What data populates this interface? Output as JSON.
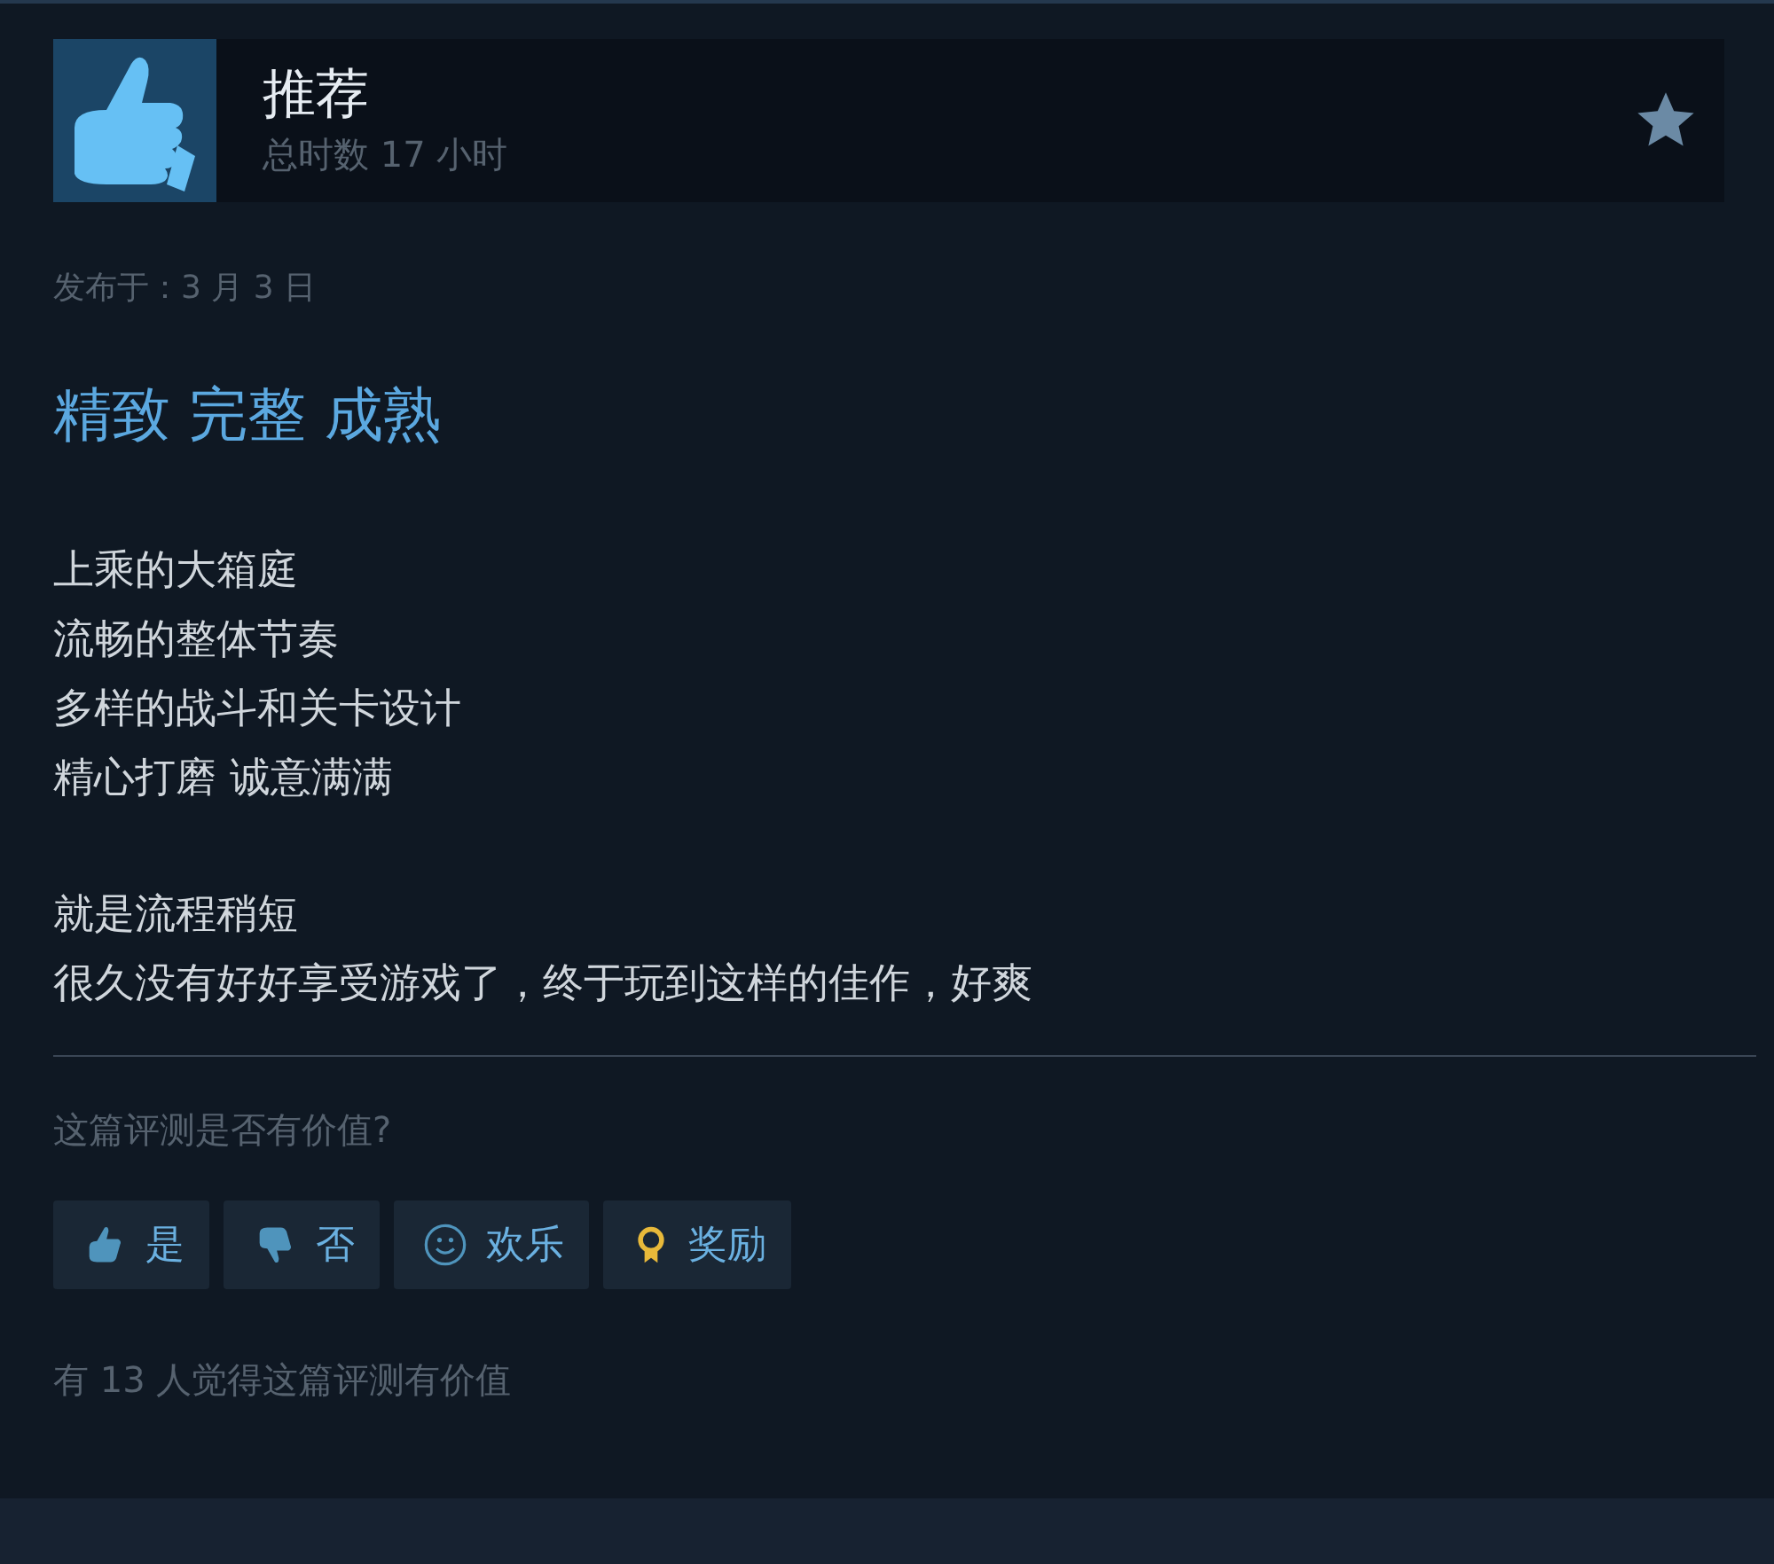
{
  "review": {
    "verdict": "推荐",
    "hours": "总时数 17 小时",
    "posted": "发布于：3 月 3 日",
    "headline": "精致 完整 成熟",
    "paragraphs": [
      [
        "上乘的大箱庭",
        "流畅的整体节奏",
        "多样的战斗和关卡设计",
        "精心打磨 诚意满满"
      ],
      [
        "就是流程稍短",
        "很久没有好好享受游戏了，终于玩到这样的佳作，好爽"
      ]
    ]
  },
  "feedback": {
    "question": "这篇评测是否有价值?",
    "buttons": [
      {
        "kind": "yes",
        "label": "是"
      },
      {
        "kind": "no",
        "label": "否"
      },
      {
        "kind": "funny",
        "label": "欢乐"
      },
      {
        "kind": "award",
        "label": "奖励"
      }
    ],
    "helpful_count": "有 13 人觉得这篇评测有价值"
  }
}
